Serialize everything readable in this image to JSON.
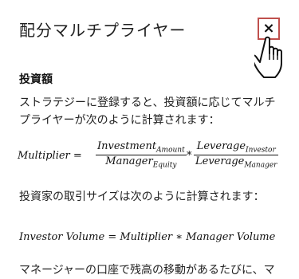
{
  "header": {
    "title": "配分マルチプライヤー"
  },
  "close": {
    "glyph": "×"
  },
  "section": {
    "heading": "投資額"
  },
  "paragraphs": {
    "p1": "ストラテジーに登録すると、投資額に応じてマルチプライヤーが次のように計算されます：",
    "p2": "投資家の取引サイズは次のように計算されます：",
    "p3": "マネージャーの口座で残高の移動があるたびに、マ"
  },
  "formula1": {
    "lhs": "Multiplier =",
    "frac1_num": "Investment",
    "frac1_num_sub": "Amount",
    "frac1_den": "Manager",
    "frac1_den_sub": "Equity",
    "op": "*",
    "frac2_num": "Leverage",
    "frac2_num_sub": "Investor",
    "frac2_den": "Leverage",
    "frac2_den_sub": "Manager"
  },
  "formula2": {
    "text": "Investor Volume  =  Multiplier  ∗  Manager Volume"
  }
}
